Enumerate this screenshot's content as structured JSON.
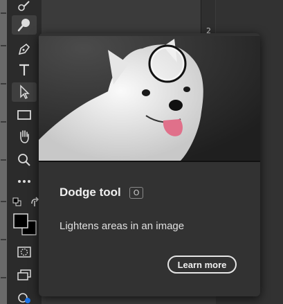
{
  "toolbar": {
    "tools": [
      "brush-tool",
      "dodge-tool",
      "pen-tool",
      "type-tool",
      "path-selection-tool",
      "rectangle-tool",
      "hand-tool",
      "zoom-tool",
      "more-tools",
      "default-colors",
      "swap-colors",
      "quick-mask",
      "screen-mode",
      "generative-tool"
    ],
    "active_tool": "dodge-tool",
    "foreground_color": "#000000",
    "background_color": "#000000"
  },
  "ruler": {
    "marker": "2"
  },
  "tooltip": {
    "title": "Dodge tool",
    "shortcut": "O",
    "description": "Lightens areas in an image",
    "learn_more": "Learn more",
    "preview": "white-dog-photo"
  }
}
